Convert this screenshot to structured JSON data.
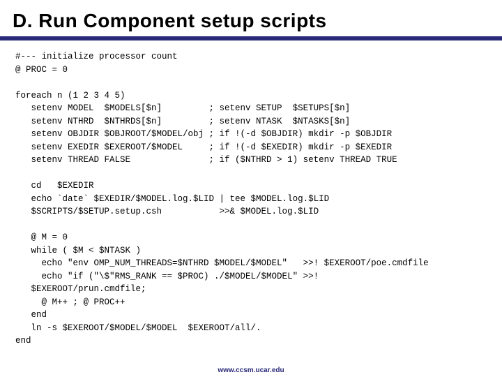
{
  "slide": {
    "title": "D. Run Component setup scripts",
    "code": "#--- initialize processor count\n@ PROC = 0\n\nforeach n (1 2 3 4 5)\n   setenv MODEL  $MODELS[$n]         ; setenv SETUP  $SETUPS[$n]\n   setenv NTHRD  $NTHRDS[$n]         ; setenv NTASK  $NTASKS[$n]\n   setenv OBJDIR $OBJROOT/$MODEL/obj ; if !(-d $OBJDIR) mkdir -p $OBJDIR\n   setenv EXEDIR $EXEROOT/$MODEL     ; if !(-d $EXEDIR) mkdir -p $EXEDIR\n   setenv THREAD FALSE               ; if ($NTHRD > 1) setenv THREAD TRUE\n\n   cd   $EXEDIR\n   echo `date` $EXEDIR/$MODEL.log.$LID | tee $MODEL.log.$LID\n   $SCRIPTS/$SETUP.setup.csh           >>& $MODEL.log.$LID\n\n   @ M = 0\n   while ( $M < $NTASK )\n     echo \"env OMP_NUM_THREADS=$NTHRD $MODEL/$MODEL\"   >>! $EXEROOT/poe.cmdfile\n     echo \"if (\"\\$\"RMS_RANK == $PROC) ./$MODEL/$MODEL\" >>!\n   $EXEROOT/prun.cmdfile;\n     @ M++ ; @ PROC++\n   end\n   ln -s $EXEROOT/$MODEL/$MODEL  $EXEROOT/all/.\nend",
    "footer": "www.ccsm.ucar.edu"
  }
}
